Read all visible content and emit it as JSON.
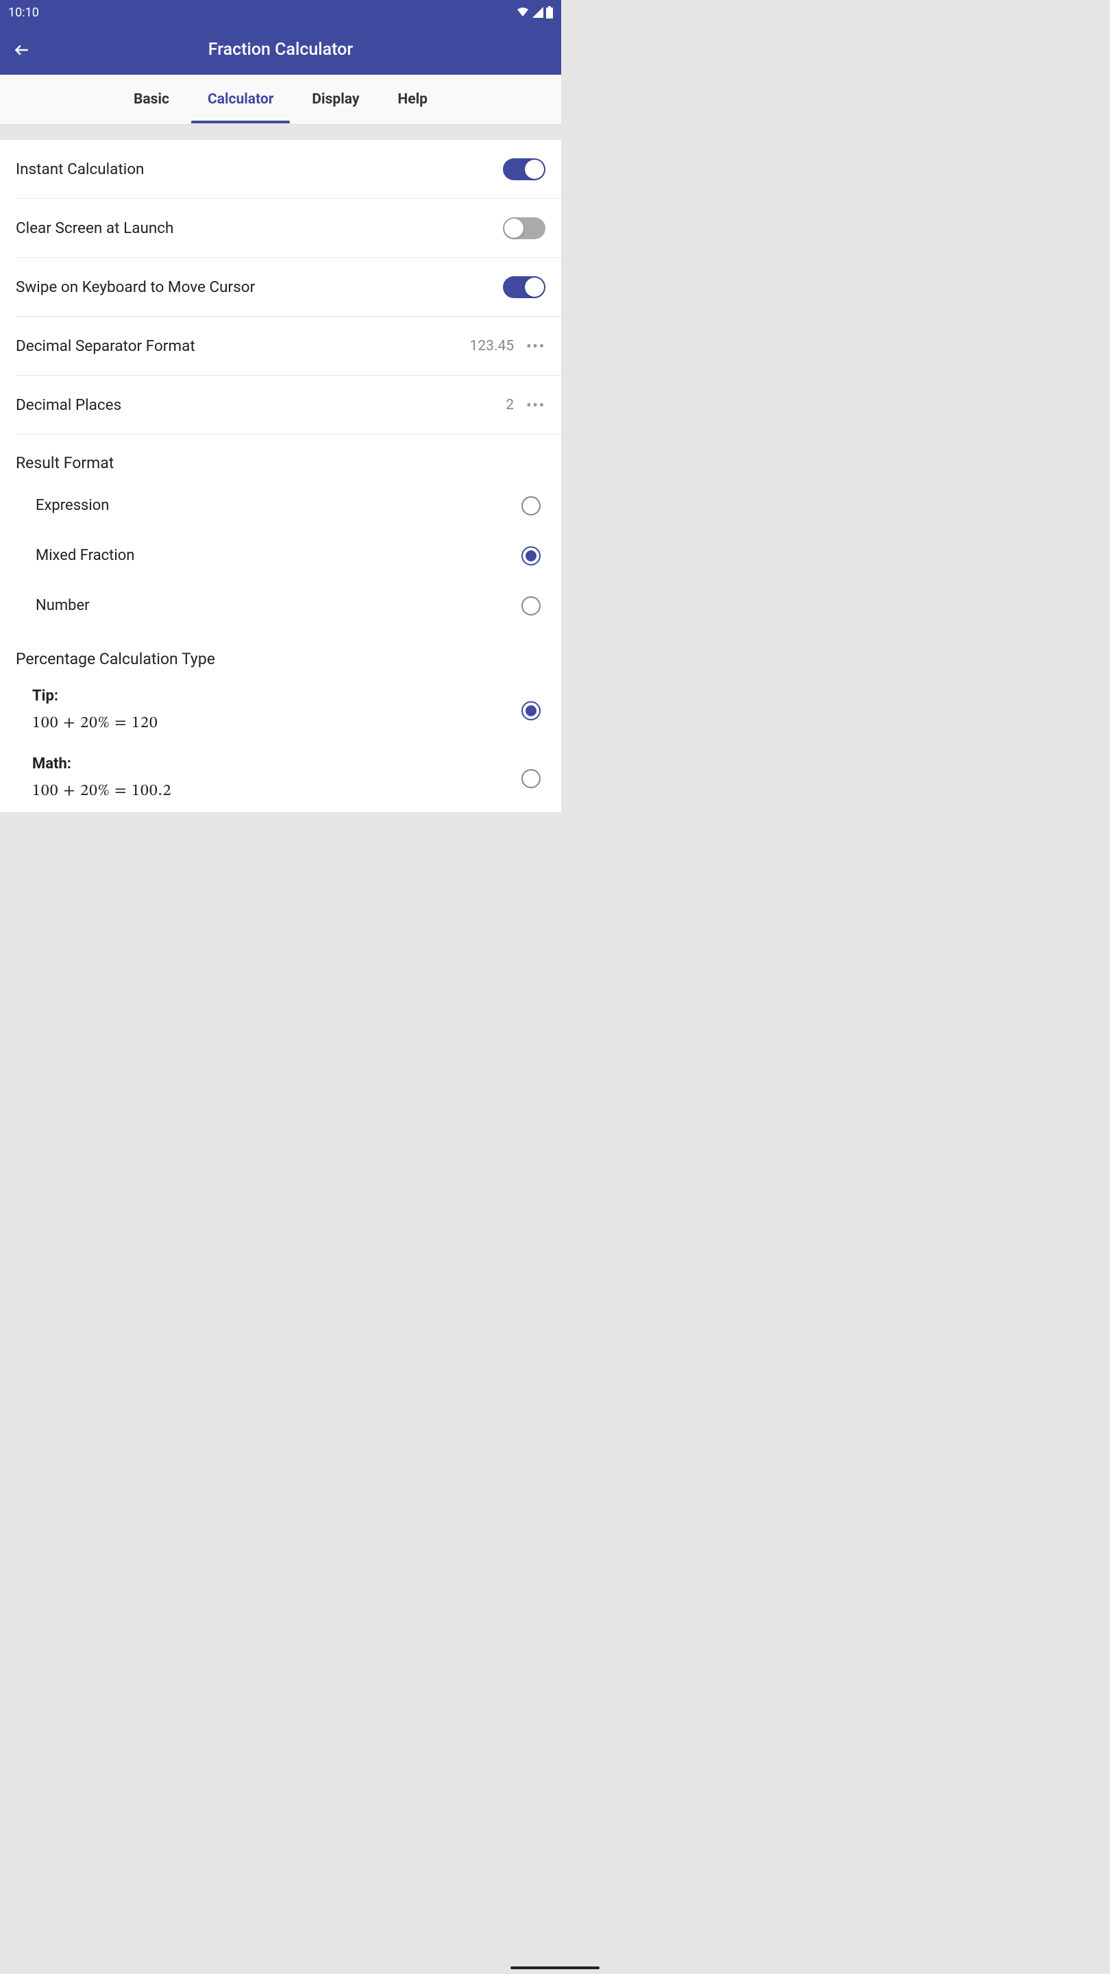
{
  "status": {
    "time": "10:10"
  },
  "header": {
    "title": "Fraction Calculator"
  },
  "tabs": {
    "basic": "Basic",
    "calculator": "Calculator",
    "display": "Display",
    "help": "Help"
  },
  "settings": {
    "instant_calc": {
      "label": "Instant Calculation",
      "on": "on"
    },
    "clear_launch": {
      "label": "Clear Screen at Launch",
      "on": "off"
    },
    "swipe_cursor": {
      "label": "Swipe on Keyboard to Move Cursor",
      "on": "on"
    },
    "decimal_sep": {
      "label": "Decimal Separator Format",
      "value": "123.45"
    },
    "decimal_places": {
      "label": "Decimal Places",
      "value": "2"
    }
  },
  "result_format": {
    "title": "Result Format",
    "options": {
      "expression": "Expression",
      "mixed": "Mixed Fraction",
      "number": "Number"
    },
    "selected": "mixed"
  },
  "pct_type": {
    "title": "Percentage Calculation Type",
    "tip": {
      "label": "Tip:",
      "formula": "100 + 20% = 120"
    },
    "math": {
      "label": "Math:",
      "formula": "100 + 20% = 100.2"
    },
    "selected": "tip"
  }
}
